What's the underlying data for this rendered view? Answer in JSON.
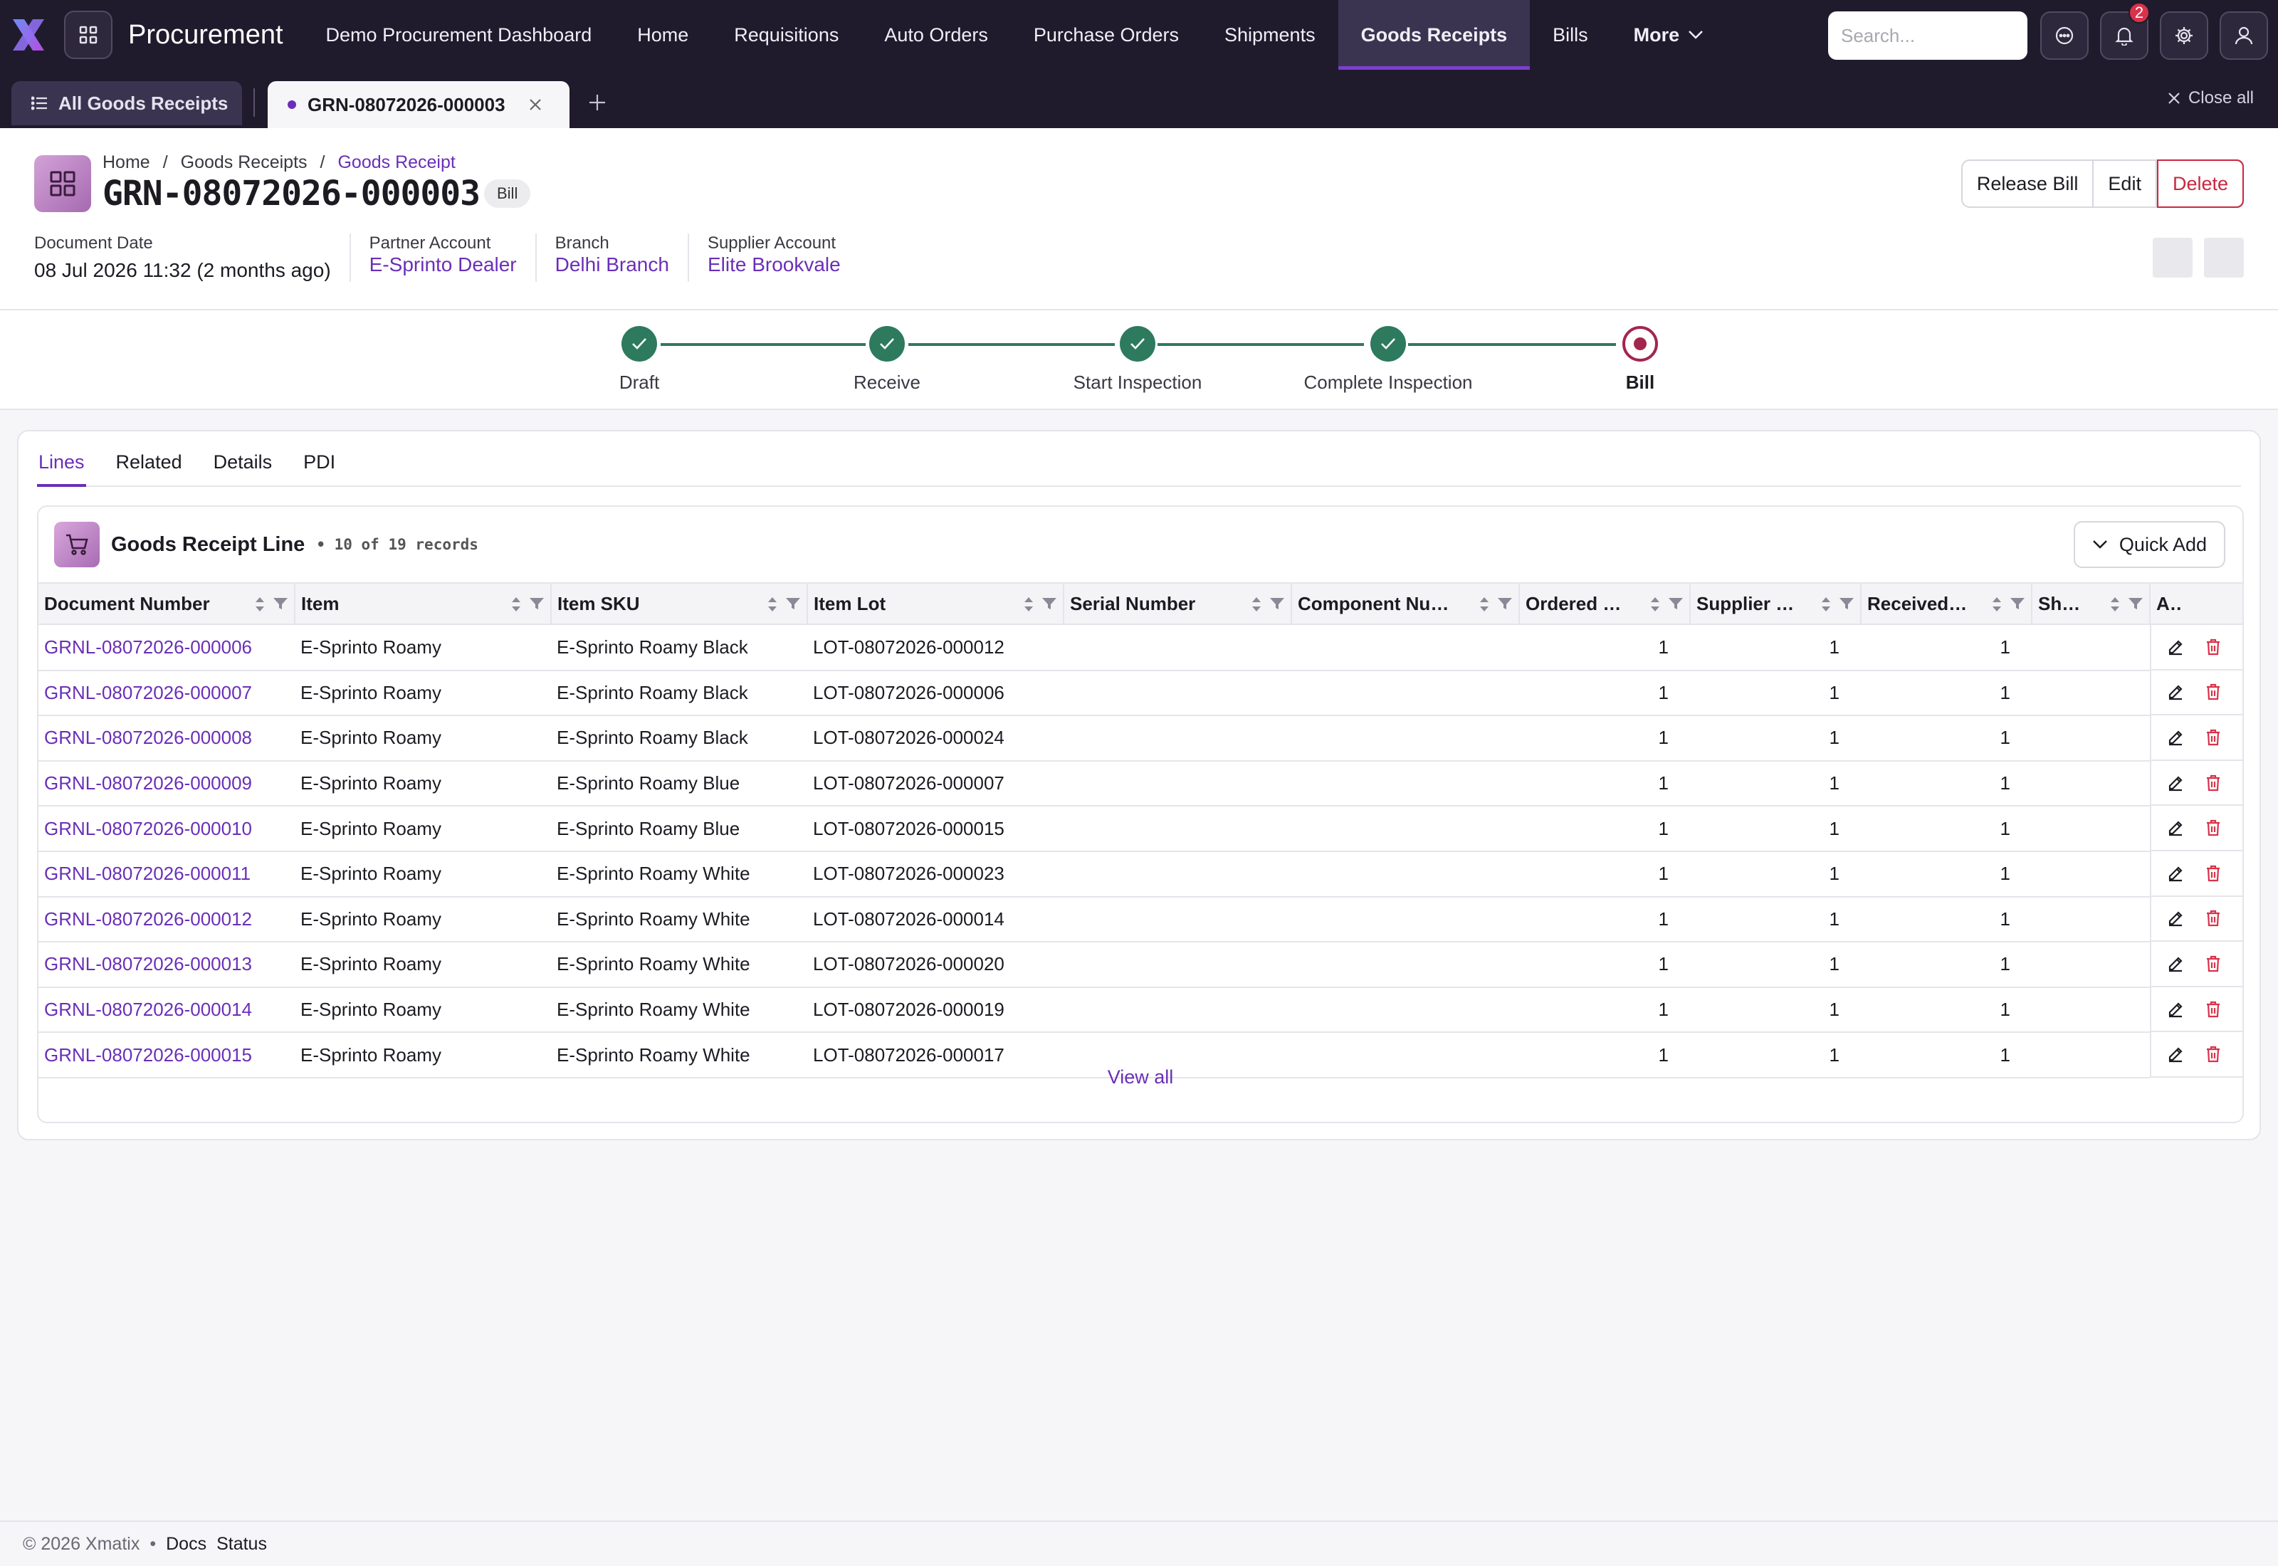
{
  "app": {
    "name": "Procurement"
  },
  "nav": {
    "items": [
      "Demo Procurement Dashboard",
      "Home",
      "Requisitions",
      "Auto Orders",
      "Purchase Orders",
      "Shipments",
      "Goods Receipts",
      "Bills"
    ],
    "active": "Goods Receipts",
    "more_label": "More"
  },
  "search": {
    "placeholder": "Search..."
  },
  "notifications": {
    "count": "2"
  },
  "tabs": {
    "all_label": "All Goods Receipts",
    "doc_label": "GRN-08072026-000003",
    "close_all": "Close all"
  },
  "breadcrumb": [
    "Home",
    "Goods Receipts",
    "Goods Receipt"
  ],
  "document": {
    "number": "GRN-08072026-000003",
    "status": "Bill",
    "actions": {
      "release": "Release Bill",
      "edit": "Edit",
      "delete": "Delete"
    },
    "meta": [
      {
        "label": "Document Date",
        "value": "08 Jul 2026 11:32 (2 months ago)",
        "link": false
      },
      {
        "label": "Partner Account",
        "value": "E-Sprinto Dealer",
        "link": true
      },
      {
        "label": "Branch",
        "value": "Delhi Branch",
        "link": true
      },
      {
        "label": "Supplier Account",
        "value": "Elite Brookvale",
        "link": true
      }
    ]
  },
  "workflow": {
    "steps": [
      "Draft",
      "Receive",
      "Start Inspection",
      "Complete Inspection",
      "Bill"
    ],
    "current": "Bill"
  },
  "subtabs": [
    "Lines",
    "Related",
    "Details",
    "PDI"
  ],
  "active_subtab": "Lines",
  "lines": {
    "title": "Goods Receipt Line",
    "count_text": "• 10 of 19 records",
    "quick_add": "Quick Add",
    "columns": [
      "Document Number",
      "Item",
      "Item SKU",
      "Item Lot",
      "Serial Number",
      "Component Num…",
      "Ordered …",
      "Supplier …",
      "Received …",
      "Shortage …",
      "Actions"
    ],
    "rows": [
      [
        "GRNL-08072026-000006",
        "E-Sprinto Roamy",
        "E-Sprinto Roamy Black",
        "LOT-08072026-000012",
        "",
        "",
        "1",
        "1",
        "1",
        ""
      ],
      [
        "GRNL-08072026-000007",
        "E-Sprinto Roamy",
        "E-Sprinto Roamy Black",
        "LOT-08072026-000006",
        "",
        "",
        "1",
        "1",
        "1",
        ""
      ],
      [
        "GRNL-08072026-000008",
        "E-Sprinto Roamy",
        "E-Sprinto Roamy Black",
        "LOT-08072026-000024",
        "",
        "",
        "1",
        "1",
        "1",
        ""
      ],
      [
        "GRNL-08072026-000009",
        "E-Sprinto Roamy",
        "E-Sprinto Roamy Blue",
        "LOT-08072026-000007",
        "",
        "",
        "1",
        "1",
        "1",
        ""
      ],
      [
        "GRNL-08072026-000010",
        "E-Sprinto Roamy",
        "E-Sprinto Roamy Blue",
        "LOT-08072026-000015",
        "",
        "",
        "1",
        "1",
        "1",
        ""
      ],
      [
        "GRNL-08072026-000011",
        "E-Sprinto Roamy",
        "E-Sprinto Roamy White",
        "LOT-08072026-000023",
        "",
        "",
        "1",
        "1",
        "1",
        ""
      ],
      [
        "GRNL-08072026-000012",
        "E-Sprinto Roamy",
        "E-Sprinto Roamy White",
        "LOT-08072026-000014",
        "",
        "",
        "1",
        "1",
        "1",
        ""
      ],
      [
        "GRNL-08072026-000013",
        "E-Sprinto Roamy",
        "E-Sprinto Roamy White",
        "LOT-08072026-000020",
        "",
        "",
        "1",
        "1",
        "1",
        ""
      ],
      [
        "GRNL-08072026-000014",
        "E-Sprinto Roamy",
        "E-Sprinto Roamy White",
        "LOT-08072026-000019",
        "",
        "",
        "1",
        "1",
        "1",
        ""
      ],
      [
        "GRNL-08072026-000015",
        "E-Sprinto Roamy",
        "E-Sprinto Roamy White",
        "LOT-08072026-000017",
        "",
        "",
        "1",
        "1",
        "1",
        ""
      ]
    ],
    "view_all": "View all"
  },
  "footer": {
    "copyright": "© 2026 Xmatix",
    "sep": "•",
    "docs": "Docs",
    "status": "Status"
  },
  "colors": {
    "accent": "#6a2fb8",
    "success": "#2d7a5f",
    "current_step": "#a3264e",
    "danger": "#c9283f",
    "nav_bg": "#1f1b2c"
  },
  "icons": [
    "xmatix-logo-icon",
    "apps-grid-icon",
    "search-icon",
    "chat-icon",
    "bell-icon",
    "gear-icon",
    "user-icon",
    "list-icon",
    "close-icon",
    "plus-icon",
    "grid-icon",
    "check-icon",
    "cart-icon",
    "chevron-down-icon",
    "sort-icon",
    "filter-icon",
    "edit-icon",
    "trash-icon"
  ]
}
